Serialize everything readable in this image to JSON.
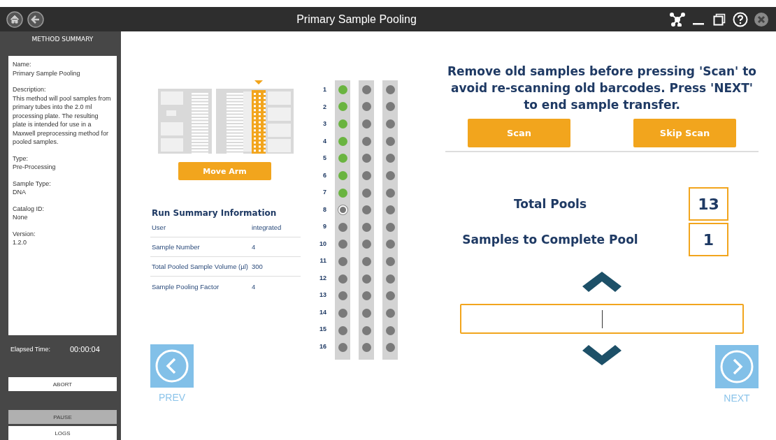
{
  "window": {
    "title": "Primary Sample Pooling"
  },
  "sidebar": {
    "header": "METHOD SUMMARY",
    "details": [
      {
        "label": "Name:",
        "value": "Primary Sample Pooling"
      },
      {
        "label": "Description:",
        "value": "This method will pool samples from primary tubes into the 2.0 ml processing plate. The resulting plate is intended for use in a Maxwell preprocessing method for pooled samples."
      },
      {
        "label": "Type:",
        "value": "Pre-Processing"
      },
      {
        "label": "Sample Type:",
        "value": "DNA"
      },
      {
        "label": "Catalog ID:",
        "value": "None"
      },
      {
        "label": "Version:",
        "value": "1.2.0"
      }
    ],
    "elapsed_label": "Elapsed Time:",
    "elapsed_value": "00:00:04",
    "buttons": [
      {
        "label": "ABORT",
        "disabled": false
      },
      {
        "label": "PAUSE",
        "disabled": true
      },
      {
        "label": "LOGS",
        "disabled": false
      }
    ]
  },
  "move_arm_button": "Move Arm",
  "run_summary": {
    "title": "Run Summary Information",
    "rows": [
      {
        "label": "User",
        "value": "integrated"
      },
      {
        "label": "Sample Number",
        "value": "4"
      },
      {
        "label": "Total Pooled Sample Volume (µl)",
        "value": "300"
      },
      {
        "label": "Sample Pooling Factor",
        "value": "4"
      }
    ]
  },
  "tube_rows": [
    "1",
    "2",
    "3",
    "4",
    "5",
    "6",
    "7",
    "8",
    "9",
    "10",
    "11",
    "12",
    "13",
    "14",
    "15",
    "16"
  ],
  "tube_columns": [
    {
      "wells": [
        {
          "kind": "done"
        },
        {
          "kind": "done"
        },
        {
          "kind": "done"
        },
        {
          "kind": "done"
        },
        {
          "kind": "done"
        },
        {
          "kind": "done"
        },
        {
          "kind": "done"
        },
        {
          "kind": "current"
        },
        {
          "kind": "empty"
        },
        {
          "kind": "empty"
        },
        {
          "kind": "empty"
        },
        {
          "kind": "empty"
        },
        {
          "kind": "empty"
        },
        {
          "kind": "empty"
        },
        {
          "kind": "empty"
        },
        {
          "kind": "empty"
        }
      ]
    },
    {
      "wells": [
        {
          "kind": "empty"
        },
        {
          "kind": "empty"
        },
        {
          "kind": "empty"
        },
        {
          "kind": "empty"
        },
        {
          "kind": "empty"
        },
        {
          "kind": "empty"
        },
        {
          "kind": "empty"
        },
        {
          "kind": "empty"
        },
        {
          "kind": "empty"
        },
        {
          "kind": "empty"
        },
        {
          "kind": "empty"
        },
        {
          "kind": "empty"
        },
        {
          "kind": "empty"
        },
        {
          "kind": "empty"
        },
        {
          "kind": "empty"
        },
        {
          "kind": "empty"
        }
      ]
    },
    {
      "wells": [
        {
          "kind": "empty"
        },
        {
          "kind": "empty"
        },
        {
          "kind": "empty"
        },
        {
          "kind": "empty"
        },
        {
          "kind": "empty"
        },
        {
          "kind": "empty"
        },
        {
          "kind": "empty"
        },
        {
          "kind": "empty"
        },
        {
          "kind": "empty"
        },
        {
          "kind": "empty"
        },
        {
          "kind": "empty"
        },
        {
          "kind": "empty"
        },
        {
          "kind": "empty"
        },
        {
          "kind": "empty"
        },
        {
          "kind": "empty"
        },
        {
          "kind": "empty"
        }
      ]
    }
  ],
  "instruction": "Remove old samples before pressing 'Scan' to avoid re-scanning old barcodes. Press 'NEXT' to end sample transfer.",
  "scan_buttons": [
    "Scan",
    "Skip Scan"
  ],
  "counters": [
    {
      "label": "Total Pools",
      "value": "13"
    },
    {
      "label": "Samples to Complete Pool",
      "value": "1"
    }
  ],
  "nav": {
    "prev": "PREV",
    "next": "NEXT"
  }
}
